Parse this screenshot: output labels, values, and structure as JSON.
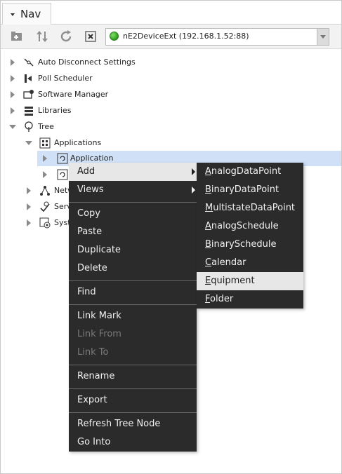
{
  "panel": {
    "title": "Nav"
  },
  "toolbar": {
    "buttons": [
      {
        "name": "add-device-button",
        "icon": "add-folder-icon"
      },
      {
        "name": "sort-button",
        "icon": "up-down-arrows-icon"
      },
      {
        "name": "refresh-button",
        "icon": "refresh-icon"
      },
      {
        "name": "close-button",
        "icon": "close-box-icon"
      }
    ],
    "ord_selector": {
      "value": "nE2DeviceExt (192.168.1.52:88)",
      "status_color": "#39b12a"
    }
  },
  "tree": {
    "items": [
      {
        "label": "Auto Disconnect Settings",
        "icon": "disconnect-icon"
      },
      {
        "label": "Poll Scheduler",
        "icon": "poll-scheduler-icon"
      },
      {
        "label": "Software Manager",
        "icon": "software-manager-icon"
      },
      {
        "label": "Libraries",
        "icon": "libraries-icon"
      },
      {
        "label": "Tree",
        "icon": "tree-icon"
      },
      {
        "label": "Applications",
        "icon": "applications-icon"
      },
      {
        "label": "Application",
        "icon": "application-icon"
      },
      {
        "label": "",
        "icon": "application-icon"
      },
      {
        "label": "Netw",
        "icon": "network-icon"
      },
      {
        "label": "Serv",
        "icon": "services-icon"
      },
      {
        "label": "Syst",
        "icon": "system-icon"
      }
    ]
  },
  "context_menu": {
    "add": "Add",
    "views": "Views",
    "copy": "Copy",
    "paste": "Paste",
    "duplicate": "Duplicate",
    "delete": "Delete",
    "find": "Find",
    "link_mark": "Link Mark",
    "link_from": "Link From",
    "link_to": "Link To",
    "rename": "Rename",
    "export": "Export",
    "refresh_tree_node": "Refresh Tree Node",
    "go_into": "Go Into"
  },
  "submenu": {
    "items": [
      {
        "first": "A",
        "rest": "nalogDataPoint"
      },
      {
        "first": "B",
        "rest": "inaryDataPoint"
      },
      {
        "first": "M",
        "rest": "ultistateDataPoint"
      },
      {
        "first": "A",
        "rest": "nalogSchedule"
      },
      {
        "first": "B",
        "rest": "inarySchedule"
      },
      {
        "first": "C",
        "rest": "alendar"
      },
      {
        "first": "E",
        "rest": "quipment"
      },
      {
        "first": "F",
        "rest": "older"
      }
    ]
  },
  "colors": {
    "menu_bg": "#2b2b2b",
    "menu_highlight": "#e7e7e7",
    "selection": "#cfe0f7"
  }
}
